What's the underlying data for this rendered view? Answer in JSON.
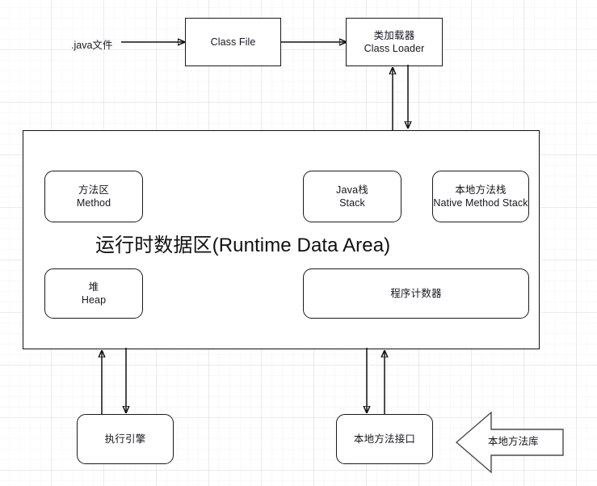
{
  "diagram": {
    "title_node": {
      "text": "运行时数据区(Runtime Data Area)"
    },
    "source_label": ".java文件",
    "nodes": {
      "class_file": {
        "cn": "",
        "en": "Class File"
      },
      "class_loader": {
        "cn": "类加载器",
        "en": "Class Loader"
      },
      "method_area": {
        "cn": "方法区",
        "en": "Method"
      },
      "java_stack": {
        "cn": "Java栈",
        "en": "Stack"
      },
      "native_method_stack": {
        "cn": "本地方法栈",
        "en": "Native Method Stack"
      },
      "heap": {
        "cn": "堆",
        "en": "Heap"
      },
      "program_counter": {
        "cn": "程序计数器",
        "en": ""
      },
      "execution_engine": {
        "cn": "执行引擎",
        "en": ""
      },
      "native_method_interface": {
        "cn": "本地方法接口",
        "en": ""
      },
      "native_method_library": {
        "cn": "本地方法库",
        "en": ""
      }
    },
    "colors": {
      "stroke": "#111111",
      "text": "#17171f",
      "background": "#ffffff",
      "grid_major": "#e8e8e8",
      "grid_minor": "#f5f5f5",
      "block_arrow_stroke": "#4a4a4a"
    }
  }
}
